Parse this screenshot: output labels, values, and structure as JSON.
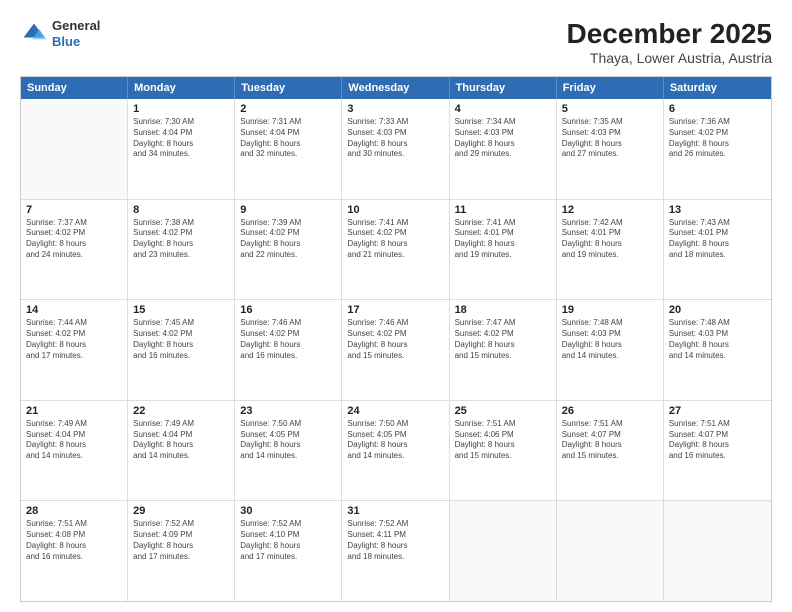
{
  "logo": {
    "general": "General",
    "blue": "Blue"
  },
  "header": {
    "month": "December 2025",
    "location": "Thaya, Lower Austria, Austria"
  },
  "days": [
    "Sunday",
    "Monday",
    "Tuesday",
    "Wednesday",
    "Thursday",
    "Friday",
    "Saturday"
  ],
  "weeks": [
    [
      {
        "day": "",
        "info": ""
      },
      {
        "day": "1",
        "info": "Sunrise: 7:30 AM\nSunset: 4:04 PM\nDaylight: 8 hours\nand 34 minutes."
      },
      {
        "day": "2",
        "info": "Sunrise: 7:31 AM\nSunset: 4:04 PM\nDaylight: 8 hours\nand 32 minutes."
      },
      {
        "day": "3",
        "info": "Sunrise: 7:33 AM\nSunset: 4:03 PM\nDaylight: 8 hours\nand 30 minutes."
      },
      {
        "day": "4",
        "info": "Sunrise: 7:34 AM\nSunset: 4:03 PM\nDaylight: 8 hours\nand 29 minutes."
      },
      {
        "day": "5",
        "info": "Sunrise: 7:35 AM\nSunset: 4:03 PM\nDaylight: 8 hours\nand 27 minutes."
      },
      {
        "day": "6",
        "info": "Sunrise: 7:36 AM\nSunset: 4:02 PM\nDaylight: 8 hours\nand 26 minutes."
      }
    ],
    [
      {
        "day": "7",
        "info": "Sunrise: 7:37 AM\nSunset: 4:02 PM\nDaylight: 8 hours\nand 24 minutes."
      },
      {
        "day": "8",
        "info": "Sunrise: 7:38 AM\nSunset: 4:02 PM\nDaylight: 8 hours\nand 23 minutes."
      },
      {
        "day": "9",
        "info": "Sunrise: 7:39 AM\nSunset: 4:02 PM\nDaylight: 8 hours\nand 22 minutes."
      },
      {
        "day": "10",
        "info": "Sunrise: 7:41 AM\nSunset: 4:02 PM\nDaylight: 8 hours\nand 21 minutes."
      },
      {
        "day": "11",
        "info": "Sunrise: 7:41 AM\nSunset: 4:01 PM\nDaylight: 8 hours\nand 19 minutes."
      },
      {
        "day": "12",
        "info": "Sunrise: 7:42 AM\nSunset: 4:01 PM\nDaylight: 8 hours\nand 19 minutes."
      },
      {
        "day": "13",
        "info": "Sunrise: 7:43 AM\nSunset: 4:01 PM\nDaylight: 8 hours\nand 18 minutes."
      }
    ],
    [
      {
        "day": "14",
        "info": "Sunrise: 7:44 AM\nSunset: 4:02 PM\nDaylight: 8 hours\nand 17 minutes."
      },
      {
        "day": "15",
        "info": "Sunrise: 7:45 AM\nSunset: 4:02 PM\nDaylight: 8 hours\nand 16 minutes."
      },
      {
        "day": "16",
        "info": "Sunrise: 7:46 AM\nSunset: 4:02 PM\nDaylight: 8 hours\nand 16 minutes."
      },
      {
        "day": "17",
        "info": "Sunrise: 7:46 AM\nSunset: 4:02 PM\nDaylight: 8 hours\nand 15 minutes."
      },
      {
        "day": "18",
        "info": "Sunrise: 7:47 AM\nSunset: 4:02 PM\nDaylight: 8 hours\nand 15 minutes."
      },
      {
        "day": "19",
        "info": "Sunrise: 7:48 AM\nSunset: 4:03 PM\nDaylight: 8 hours\nand 14 minutes."
      },
      {
        "day": "20",
        "info": "Sunrise: 7:48 AM\nSunset: 4:03 PM\nDaylight: 8 hours\nand 14 minutes."
      }
    ],
    [
      {
        "day": "21",
        "info": "Sunrise: 7:49 AM\nSunset: 4:04 PM\nDaylight: 8 hours\nand 14 minutes."
      },
      {
        "day": "22",
        "info": "Sunrise: 7:49 AM\nSunset: 4:04 PM\nDaylight: 8 hours\nand 14 minutes."
      },
      {
        "day": "23",
        "info": "Sunrise: 7:50 AM\nSunset: 4:05 PM\nDaylight: 8 hours\nand 14 minutes."
      },
      {
        "day": "24",
        "info": "Sunrise: 7:50 AM\nSunset: 4:05 PM\nDaylight: 8 hours\nand 14 minutes."
      },
      {
        "day": "25",
        "info": "Sunrise: 7:51 AM\nSunset: 4:06 PM\nDaylight: 8 hours\nand 15 minutes."
      },
      {
        "day": "26",
        "info": "Sunrise: 7:51 AM\nSunset: 4:07 PM\nDaylight: 8 hours\nand 15 minutes."
      },
      {
        "day": "27",
        "info": "Sunrise: 7:51 AM\nSunset: 4:07 PM\nDaylight: 8 hours\nand 16 minutes."
      }
    ],
    [
      {
        "day": "28",
        "info": "Sunrise: 7:51 AM\nSunset: 4:08 PM\nDaylight: 8 hours\nand 16 minutes."
      },
      {
        "day": "29",
        "info": "Sunrise: 7:52 AM\nSunset: 4:09 PM\nDaylight: 8 hours\nand 17 minutes."
      },
      {
        "day": "30",
        "info": "Sunrise: 7:52 AM\nSunset: 4:10 PM\nDaylight: 8 hours\nand 17 minutes."
      },
      {
        "day": "31",
        "info": "Sunrise: 7:52 AM\nSunset: 4:11 PM\nDaylight: 8 hours\nand 18 minutes."
      },
      {
        "day": "",
        "info": ""
      },
      {
        "day": "",
        "info": ""
      },
      {
        "day": "",
        "info": ""
      }
    ]
  ]
}
